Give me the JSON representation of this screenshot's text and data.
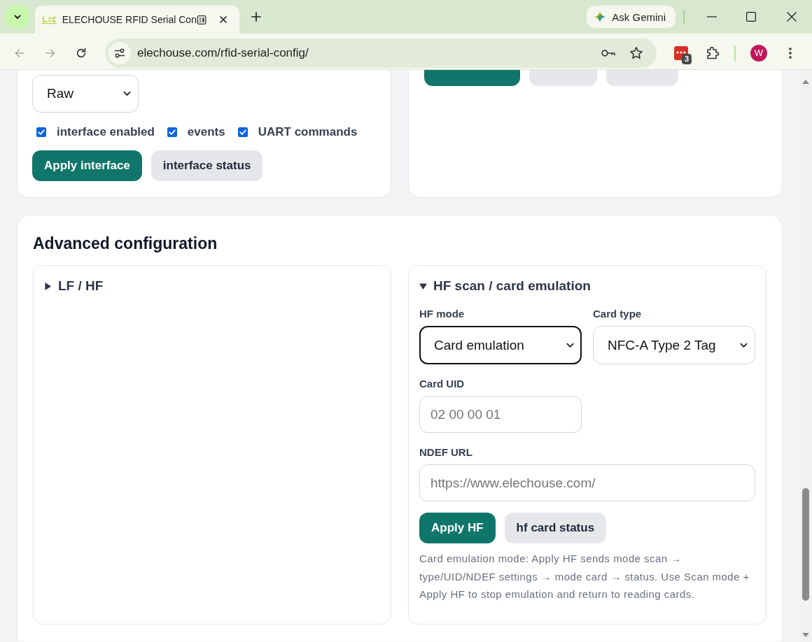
{
  "browser": {
    "tab": {
      "title": "ELECHOUSE RFID Serial Con",
      "selected": true
    },
    "ask_gemini": "Ask Gemini",
    "nav_buttons": [
      {
        "kind": "back",
        "disabled": true
      },
      {
        "kind": "forward",
        "disabled": true
      },
      {
        "kind": "reload",
        "disabled": false
      }
    ],
    "url": "elechouse.com/rfid-serial-config/",
    "extension_badge": "3",
    "profile_initial": "W"
  },
  "interface_card": {
    "format_select": {
      "value": "Raw"
    },
    "options": [
      {
        "label": "interface enabled",
        "checked": true
      },
      {
        "label": "events",
        "checked": true
      },
      {
        "label": "UART commands",
        "checked": true
      }
    ],
    "buttons": [
      {
        "label": "Apply interface",
        "kind": "primary"
      },
      {
        "label": "interface status",
        "kind": "secondary"
      }
    ]
  },
  "second_card": {
    "buttons": [
      {
        "kind": "primary"
      },
      {
        "kind": "secondary"
      },
      {
        "kind": "secondary"
      }
    ]
  },
  "advanced": {
    "title": "Advanced configuration",
    "panels": [
      {
        "title": "LF / HF",
        "expanded": false
      },
      {
        "title": "HF scan / card emulation",
        "expanded": true,
        "fields": [
          {
            "kind": "select",
            "label": "HF mode",
            "value": "Card emulation",
            "focused": true
          },
          {
            "kind": "select",
            "label": "Card type",
            "value": "NFC-A Type 2 Tag",
            "focused": false
          },
          {
            "kind": "text",
            "label": "Card UID",
            "placeholder": "02 00 00 01"
          },
          {
            "kind": "url",
            "label": "NDEF URL",
            "placeholder": "https://www.elechouse.com/"
          }
        ],
        "buttons": [
          {
            "label": "Apply HF",
            "kind": "primary"
          },
          {
            "label": "hf card status",
            "kind": "secondary"
          }
        ],
        "note": "Card emulation mode: Apply HF sends mode scan → type/UID/NDEF settings → mode card → status. Use Scan mode + Apply HF to stop emulation and return to reading cards."
      }
    ]
  }
}
